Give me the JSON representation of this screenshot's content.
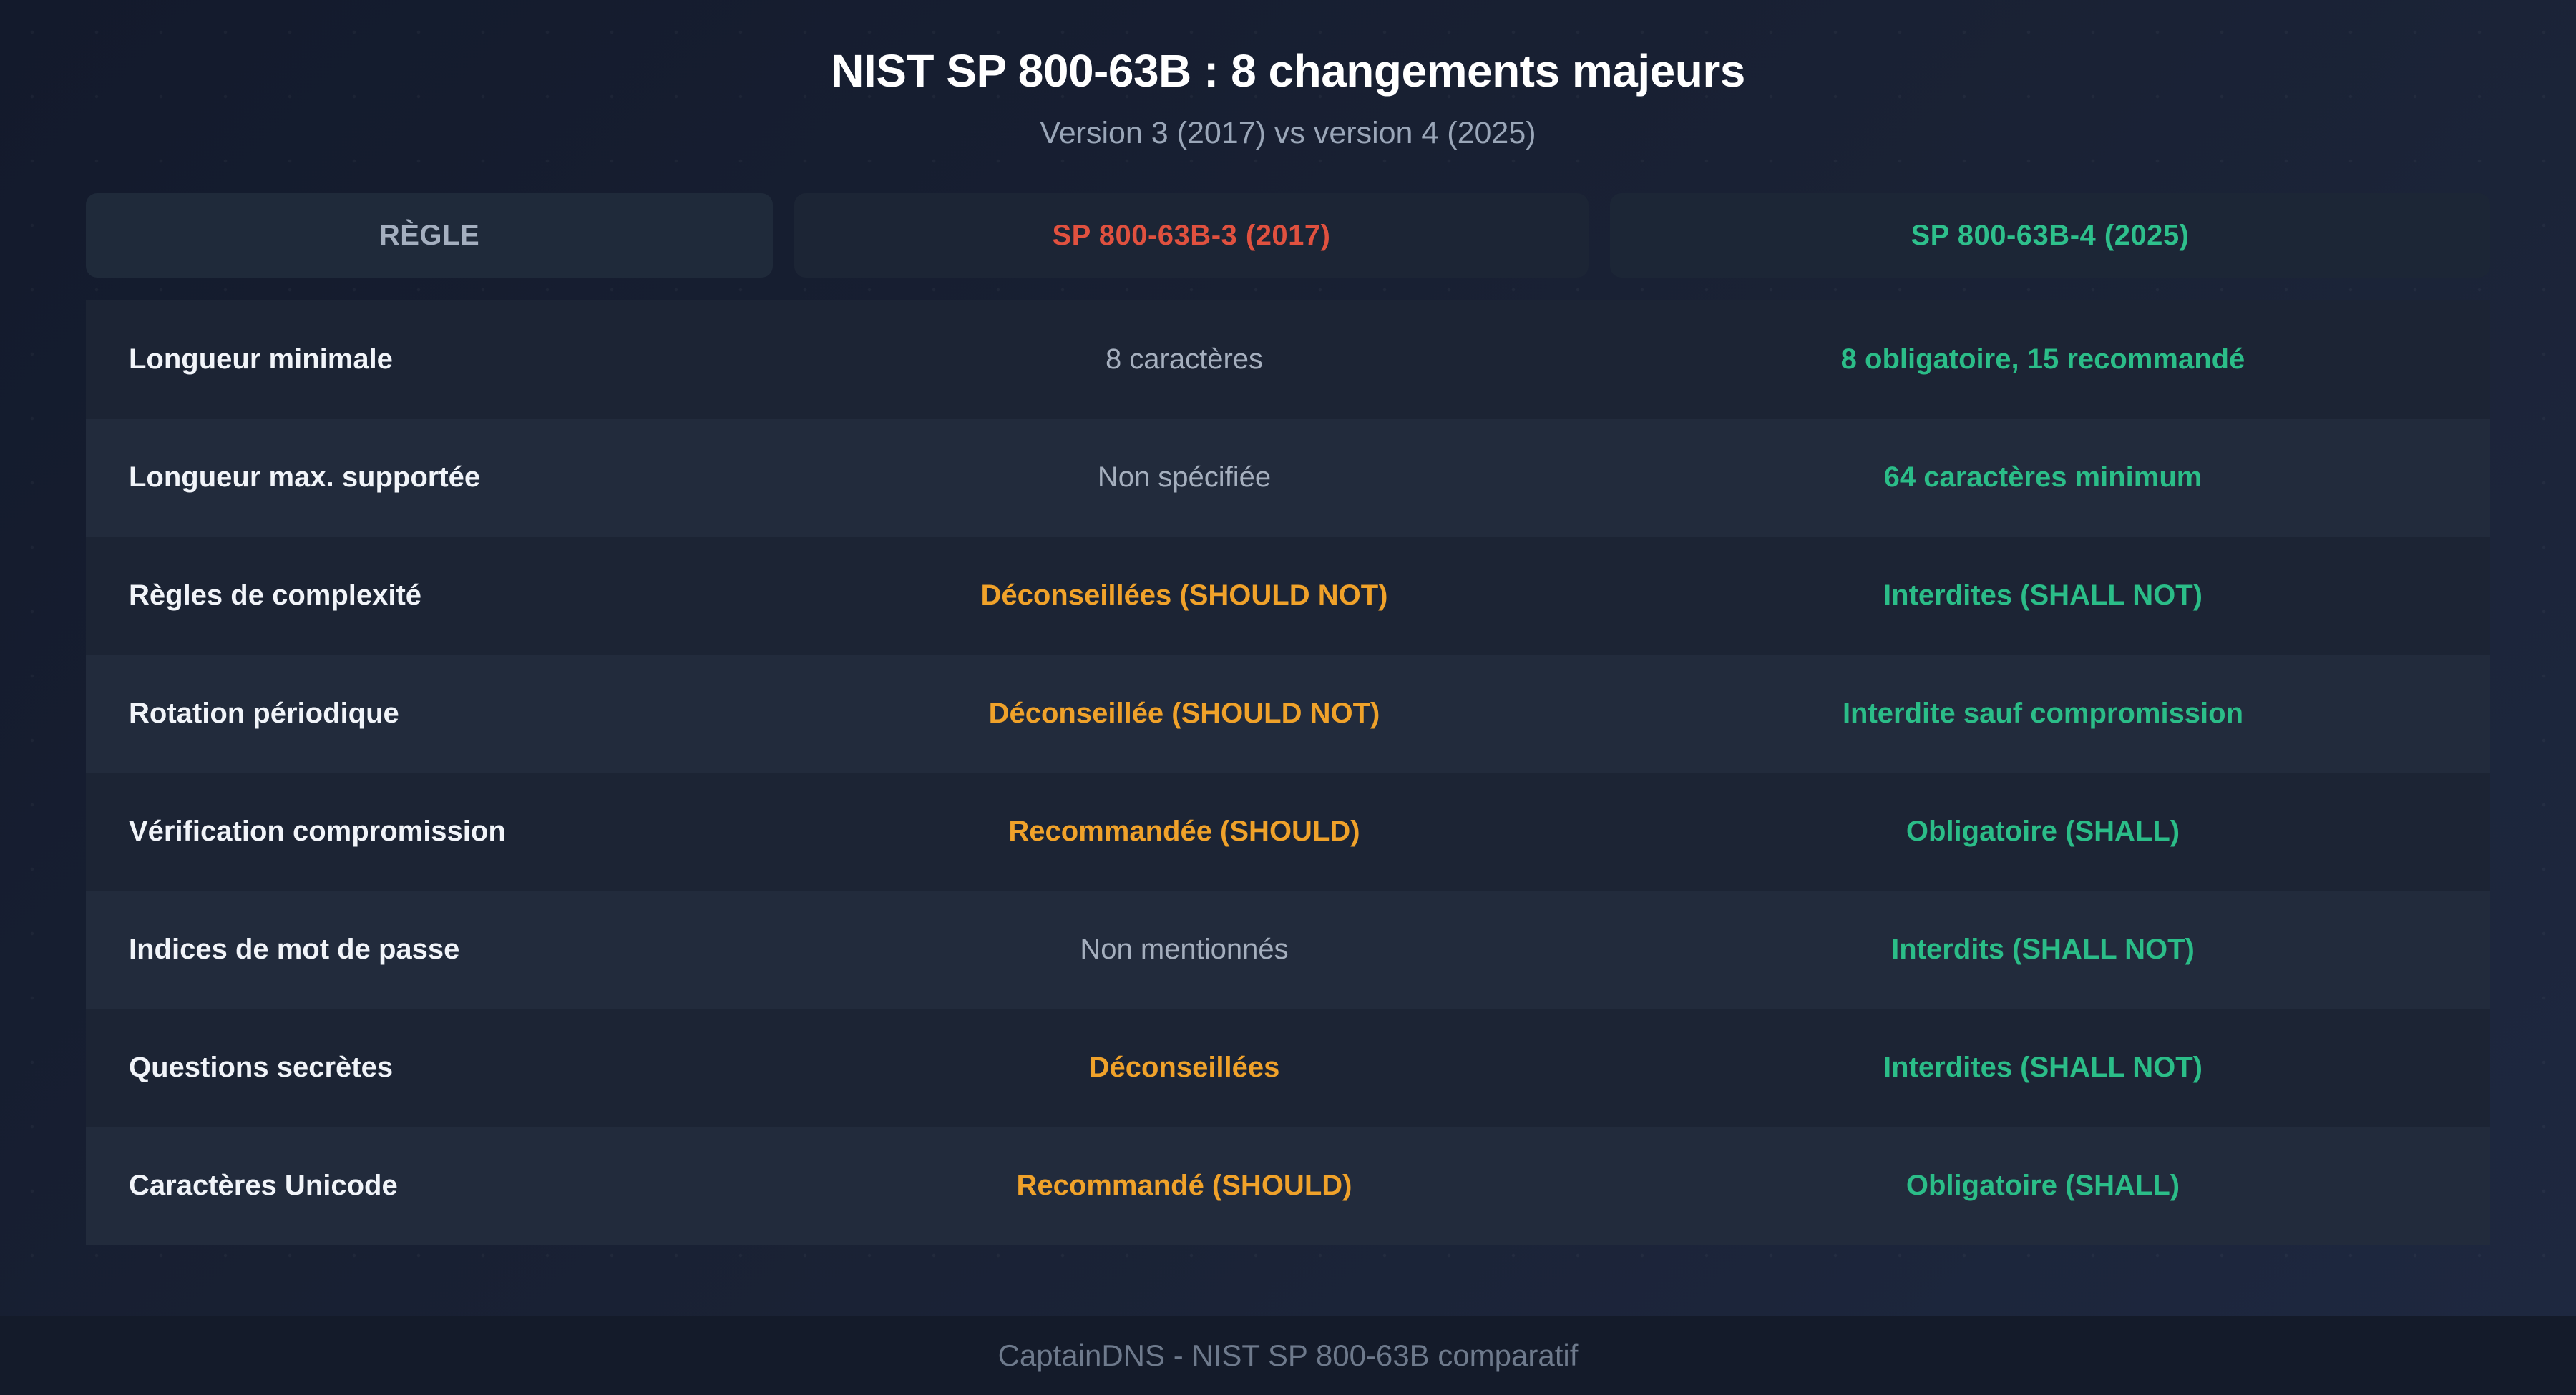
{
  "title": "NIST SP 800-63B : 8 changements majeurs",
  "subtitle": "Version 3 (2017) vs version 4 (2025)",
  "header": {
    "rule": "RÈGLE",
    "v3": "SP 800-63B-3 (2017)",
    "v4": "SP 800-63B-4 (2025)"
  },
  "colors": {
    "v3_header": "#e0513f",
    "v4_header": "#2ec08c",
    "warning_value": "#f0a22a",
    "positive_value": "#2bbd88",
    "neutral_value": "#a5afbe"
  },
  "rows": [
    {
      "rule": "Longueur minimale",
      "v3": "8 caractères",
      "v3_status": "neutral",
      "v4": "8 obligatoire, 15 recommandé"
    },
    {
      "rule": "Longueur max. supportée",
      "v3": "Non spécifiée",
      "v3_status": "neutral",
      "v4": "64 caractères minimum"
    },
    {
      "rule": "Règles de complexité",
      "v3": "Déconseillées (SHOULD NOT)",
      "v3_status": "warn",
      "v4": "Interdites (SHALL NOT)"
    },
    {
      "rule": "Rotation périodique",
      "v3": "Déconseillée (SHOULD NOT)",
      "v3_status": "warn",
      "v4": "Interdite sauf compromission"
    },
    {
      "rule": "Vérification compromission",
      "v3": "Recommandée (SHOULD)",
      "v3_status": "warn",
      "v4": "Obligatoire (SHALL)"
    },
    {
      "rule": "Indices de mot de passe",
      "v3": "Non mentionnés",
      "v3_status": "neutral",
      "v4": "Interdits (SHALL NOT)"
    },
    {
      "rule": "Questions secrètes",
      "v3": "Déconseillées",
      "v3_status": "warn",
      "v4": "Interdites (SHALL NOT)"
    },
    {
      "rule": "Caractères Unicode",
      "v3": "Recommandé (SHOULD)",
      "v3_status": "warn",
      "v4": "Obligatoire (SHALL)"
    }
  ],
  "footer": "CaptainDNS - NIST SP 800-63B comparatif"
}
